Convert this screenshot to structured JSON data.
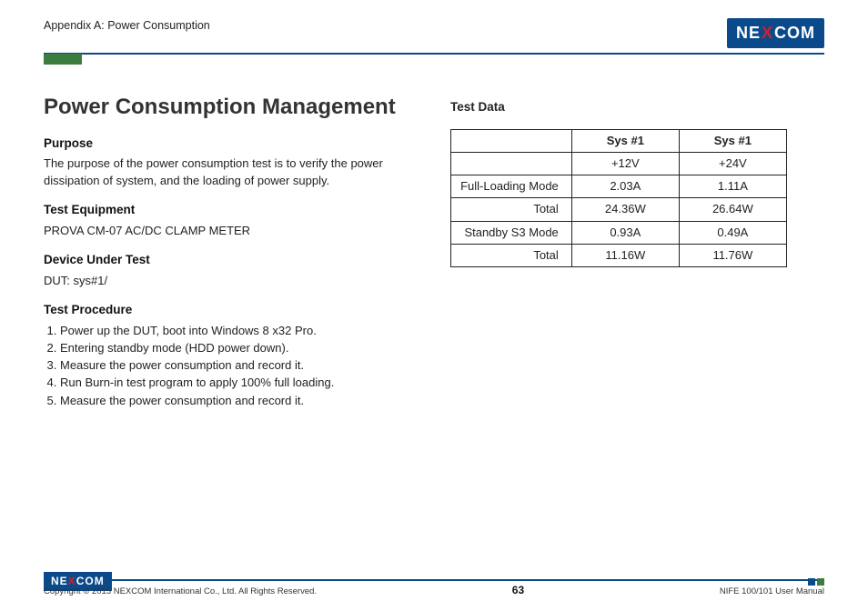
{
  "header": {
    "section": "Appendix A: Power Consumption",
    "logo_text": "NE COM",
    "logo_x": "X"
  },
  "main": {
    "title": "Power Consumption Management",
    "purpose": {
      "heading": "Purpose",
      "text": "The purpose of the power consumption test is to verify the power dissipation of system, and the loading of power supply."
    },
    "equipment": {
      "heading": "Test Equipment",
      "text": "PROVA CM-07 AC/DC CLAMP METER"
    },
    "dut": {
      "heading": "Device Under Test",
      "text": "DUT: sys#1/"
    },
    "procedure": {
      "heading": "Test Procedure",
      "steps": [
        "Power up the DUT, boot into Windows 8 x32 Pro.",
        "Entering standby mode (HDD power down).",
        "Measure the power consumption and record it.",
        "Run Burn-in test program to apply 100% full loading.",
        "Measure the power consumption and record it."
      ]
    },
    "testdata": {
      "heading": "Test Data",
      "columns": [
        "",
        "Sys #1",
        "Sys #1"
      ],
      "rows": [
        [
          "",
          "+12V",
          "+24V"
        ],
        [
          "Full-Loading Mode",
          "2.03A",
          "1.11A"
        ],
        [
          "Total",
          "24.36W",
          "26.64W"
        ],
        [
          "Standby S3 Mode",
          "0.93A",
          "0.49A"
        ],
        [
          "Total",
          "11.16W",
          "11.76W"
        ]
      ]
    }
  },
  "footer": {
    "copyright": "Copyright © 2015 NEXCOM International Co., Ltd. All Rights Reserved.",
    "page": "63",
    "manual": "NIFE 100/101 User Manual"
  }
}
